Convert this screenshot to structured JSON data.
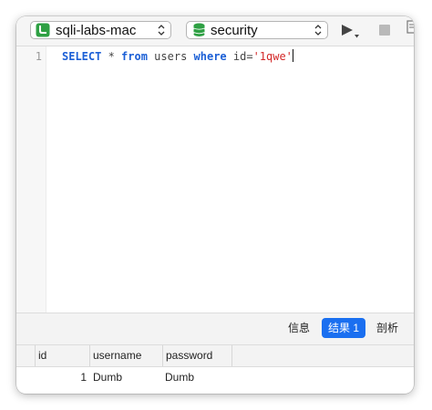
{
  "toolbar": {
    "connection": "sqli-labs-mac",
    "database": "security",
    "icons": {
      "connection": "connection-icon",
      "database": "database-icon",
      "run": "run-icon",
      "stop": "stop-icon",
      "document": "document-icon"
    }
  },
  "editor": {
    "line_number": "1",
    "tokens": {
      "select": "SELECT",
      "star": " * ",
      "from": "from",
      "table": " users ",
      "where": "where",
      "cond": " id=",
      "str": "'1qwe'"
    }
  },
  "tabs": {
    "info": "信息",
    "result": "结果 1",
    "profile": "剖析"
  },
  "results": {
    "columns": [
      "id",
      "username",
      "password"
    ],
    "rows": [
      [
        "1",
        "Dumb",
        "Dumb"
      ]
    ]
  },
  "colors": {
    "accent": "#1a6ff0",
    "keyword": "#1b5fd6",
    "string": "#d32727",
    "conn_green": "#2ea043"
  }
}
